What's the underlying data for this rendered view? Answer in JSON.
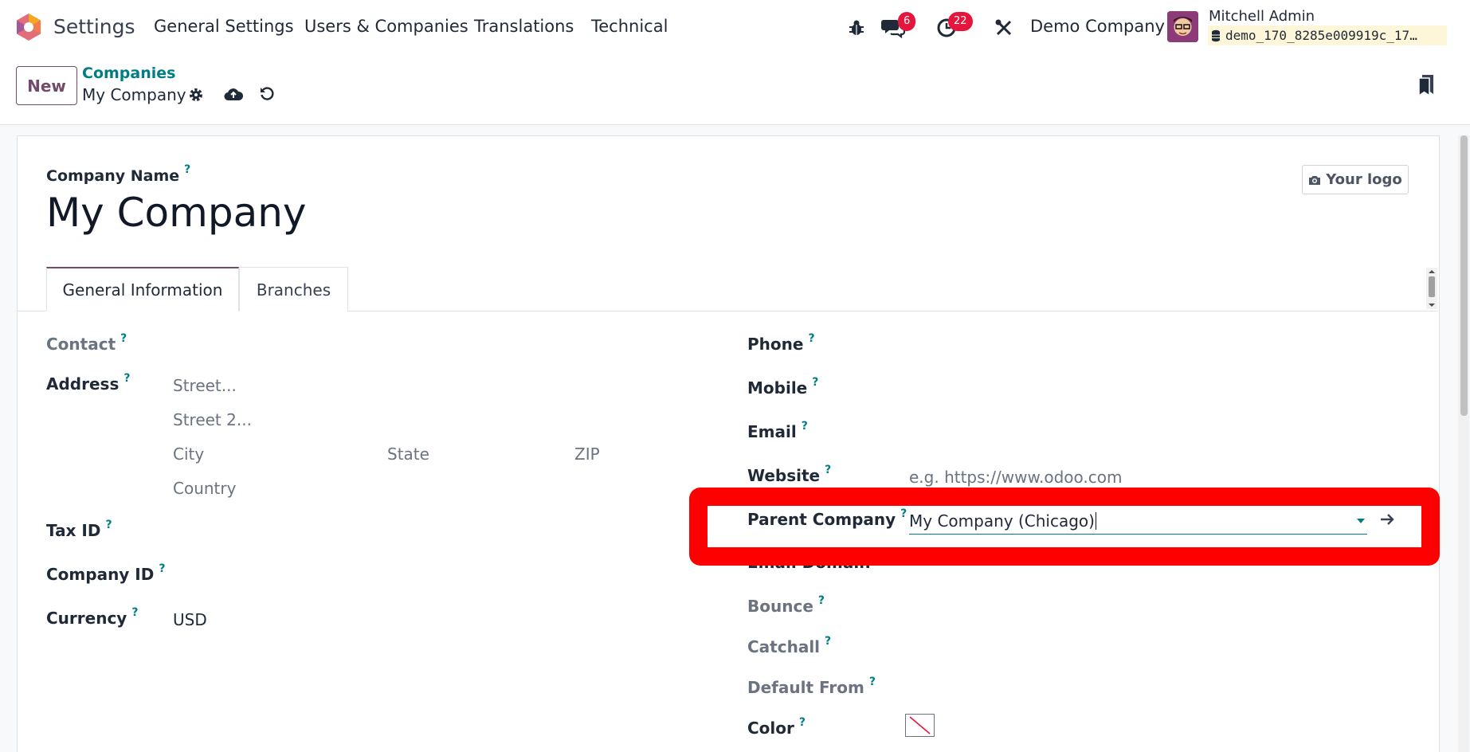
{
  "navbar": {
    "app_name": "Settings",
    "menu": [
      "General Settings",
      "Users & Companies",
      "Translations",
      "Technical"
    ],
    "messages_count": "6",
    "activities_count": "22",
    "company_switch": "Demo Company",
    "user_name": "Mitchell Admin",
    "database": "demo_170_8285e009919c_17…"
  },
  "control_panel": {
    "new_label": "New",
    "breadcrumb_parent": "Companies",
    "record_name": "My Company"
  },
  "form": {
    "company_name_label": "Company Name",
    "company_name": "My Company",
    "logo_label": "Your logo",
    "tabs": [
      "General Information",
      "Branches"
    ],
    "active_tab": "General Information",
    "left": {
      "contact_label": "Contact",
      "address_label": "Address",
      "street_ph": "Street...",
      "street2_ph": "Street 2...",
      "city_ph": "City",
      "state_ph": "State",
      "zip_ph": "ZIP",
      "country_ph": "Country",
      "tax_id_label": "Tax ID",
      "company_id_label": "Company ID",
      "currency_label": "Currency",
      "currency_value": "USD"
    },
    "right": {
      "phone_label": "Phone",
      "mobile_label": "Mobile",
      "email_label": "Email",
      "website_label": "Website",
      "website_ph": "e.g. https://www.odoo.com",
      "parent_company_label": "Parent Company",
      "parent_company_value": "My Company (Chicago)",
      "email_domain_label": "Email Domain",
      "bounce_label": "Bounce",
      "catchall_label": "Catchall",
      "default_from_label": "Default From",
      "color_label": "Color"
    },
    "qmark": "?"
  },
  "colors": {
    "brand": "#714b67",
    "accent": "#017e84",
    "badge": "#e5163d",
    "highlight": "#ff0000"
  }
}
